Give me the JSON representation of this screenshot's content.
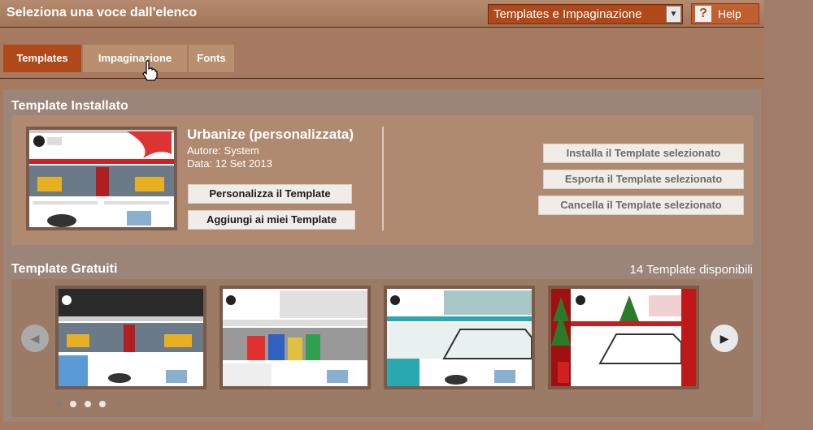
{
  "header": {
    "title": "Seleziona una voce dall'elenco",
    "select_value": "Templates e Impaginazione",
    "help_label": "Help",
    "help_icon": "?"
  },
  "tabs": [
    {
      "label": "Templates",
      "active": true
    },
    {
      "label": "Impaginazione",
      "active": false
    },
    {
      "label": "Fonts",
      "active": false
    }
  ],
  "installed": {
    "section_title": "Template Installato",
    "name": "Urbanize (personalizzata)",
    "author": "Autore: System",
    "date": "Data: 12 Set 2013",
    "btn_customize": "Personalizza il Template",
    "btn_add": "Aggiungi ai miei Template",
    "btn_install": "Installa il Template selezionato",
    "btn_export": "Esporta il Template selezionato",
    "btn_delete": "Cancella il Template selezionato"
  },
  "free": {
    "section_title": "Template Gratuiti",
    "count_label": "14 Template disponibili",
    "thumbnails": [
      "template-urbanize",
      "template-fashion",
      "template-city",
      "template-christmas"
    ],
    "dots": 4,
    "active_dot": 0
  },
  "icons": {
    "prev": "chevron-left-icon",
    "next": "chevron-right-icon",
    "cursor": "hand-cursor-icon"
  },
  "colors": {
    "accent": "#b0491a",
    "background": "#a57a60"
  }
}
